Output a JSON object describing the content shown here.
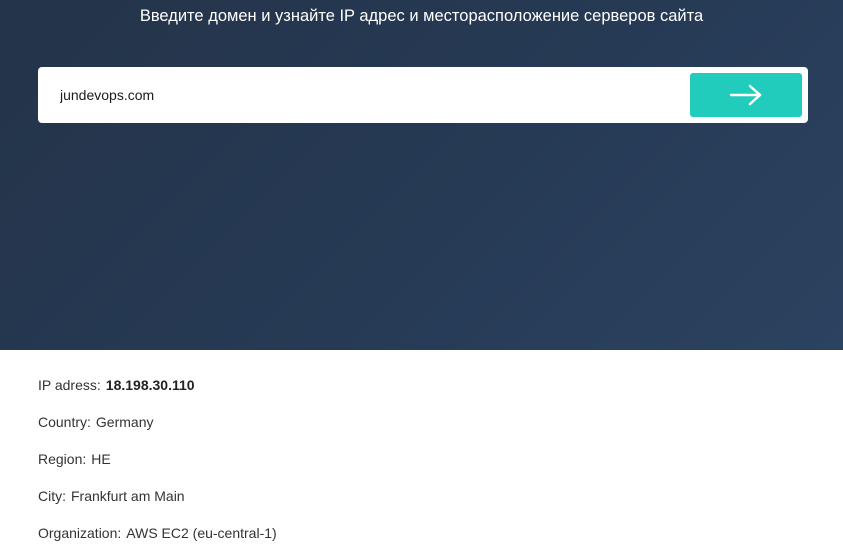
{
  "hero": {
    "title": "Введите домен и узнайте IP адрес и месторасположение серверов сайта"
  },
  "search": {
    "value": "jundevops.com",
    "button_icon": "arrow-right-icon",
    "button_color": "#22ccbc"
  },
  "results": {
    "ip": {
      "label": "IP adress:",
      "value": "18.198.30.110"
    },
    "country": {
      "label": "Country:",
      "value": "Germany"
    },
    "region": {
      "label": "Region:",
      "value": "HE"
    },
    "city": {
      "label": "City:",
      "value": "Frankfurt am Main"
    },
    "organization": {
      "label": "Organization:",
      "value": "AWS EC2 (eu-central-1)"
    }
  }
}
